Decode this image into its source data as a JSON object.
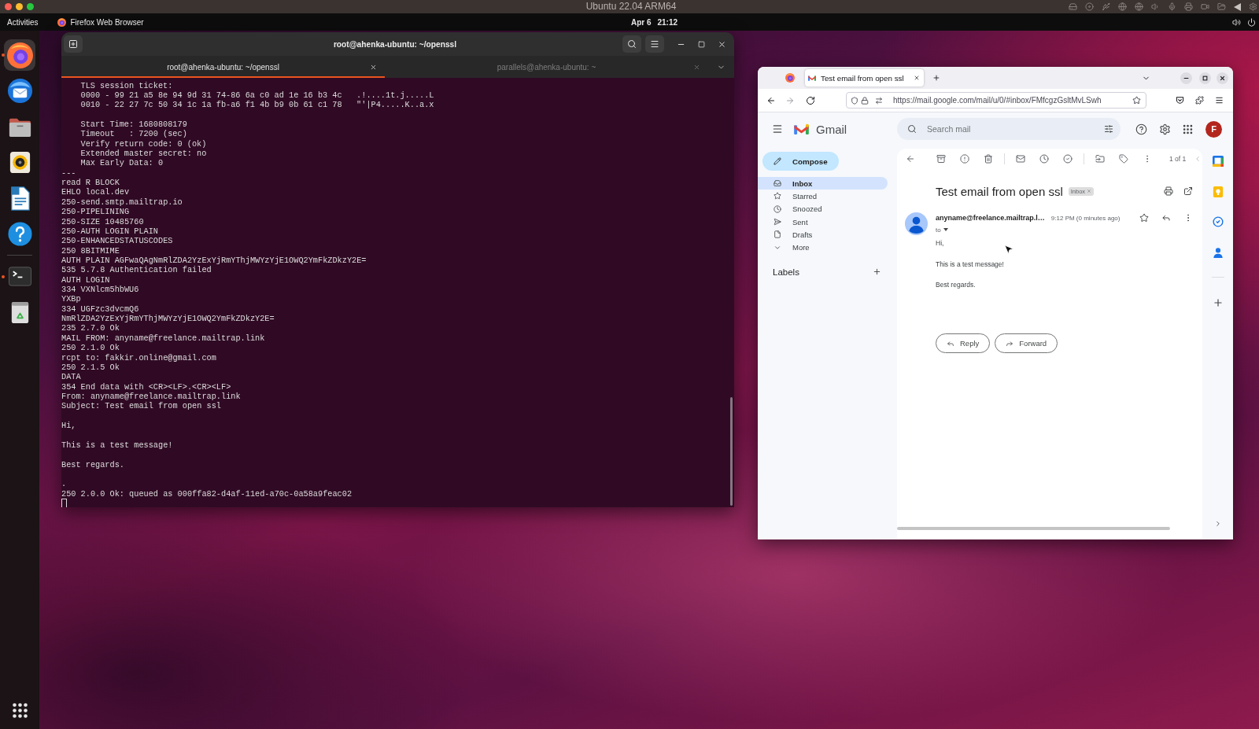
{
  "host_window": {
    "title": "Ubuntu 22.04 ARM64"
  },
  "top_bar": {
    "activities": "Activities",
    "app_menu": "Firefox Web Browser",
    "date": "Apr 6",
    "time": "21:12"
  },
  "dock": {
    "items": [
      {
        "kind": "browser",
        "running": true,
        "selected": true
      },
      {
        "kind": "mail",
        "running": false,
        "selected": false
      },
      {
        "kind": "files",
        "running": false,
        "selected": false
      },
      {
        "kind": "music",
        "running": false,
        "selected": false
      },
      {
        "kind": "writer",
        "running": false,
        "selected": false
      },
      {
        "kind": "help",
        "running": false,
        "selected": false
      }
    ],
    "extra_items": [
      {
        "kind": "terminal",
        "running": true,
        "selected": false
      },
      {
        "kind": "trash",
        "running": false,
        "selected": false
      }
    ]
  },
  "terminal": {
    "title": "root@ahenka-ubuntu: ~/openssl",
    "tabs": [
      {
        "label": "root@ahenka-ubuntu: ~/openssl",
        "selected": true
      },
      {
        "label": "parallels@ahenka-ubuntu: ~",
        "selected": false
      }
    ],
    "paragraphs": [
      {
        "indented_lines": [
          "TLS session ticket:",
          "0000 - 99 21 a5 8e 94 9d 31 74-86 6a c0 ad 1e 16 b3 4c   .!....1t.j.....L",
          "0010 - 22 27 7c 50 34 1c 1a fb-a6 f1 4b b9 0b 61 c1 78   \"'|P4.....K..a.x"
        ]
      },
      {
        "indented_lines": [
          "Start Time: 1680808179",
          "Timeout   : 7200 (sec)",
          "Verify return code: 0 (ok)",
          "Extended master secret: no",
          "Max Early Data: 0"
        ],
        "lines": [
          "---",
          "read R BLOCK",
          "EHLO local.dev",
          "250-send.smtp.mailtrap.io",
          "250-PIPELINING",
          "250-SIZE 10485760",
          "250-AUTH LOGIN PLAIN",
          "250-ENHANCEDSTATUSCODES",
          "250 8BITMIME",
          "AUTH PLAIN AGFwaQAgNmRlZDA2YzExYjRmYThjMWYzYjE1OWQ2YmFkZDkzY2E=",
          "535 5.7.8 Authentication failed",
          "AUTH LOGIN",
          "334 VXNlcm5hbWU6",
          "YXBp",
          "334 UGFzc3dvcmQ6",
          "NmRlZDA2YzExYjRmYThjMWYzYjE1OWQ2YmFkZDkzY2E=",
          "235 2.7.0 Ok",
          "MAIL FROM: anyname@freelance.mailtrap.link",
          "250 2.1.0 Ok",
          "rcpt to: fakkir.online@gmail.com",
          "250 2.1.5 Ok",
          "DATA",
          "354 End data with <CR><LF>.<CR><LF>",
          "From: anyname@freelance.mailtrap.link",
          "Subject: Test email from open ssl"
        ]
      },
      {
        "lines": [
          "Hi,"
        ]
      },
      {
        "lines": [
          "This is a test message!"
        ]
      },
      {
        "lines": [
          "Best regards."
        ]
      },
      {
        "lines": [
          ".",
          "250 2.0.0 Ok: queued as 000ffa82-d4af-11ed-a70c-0a58a9feac02"
        ]
      }
    ]
  },
  "browser": {
    "tabs": [
      {
        "title": "Test email from open ssl",
        "selected": true
      }
    ],
    "url": "https://mail.google.com/mail/u/0/#inbox/FMfcgzGsltMvLSwh",
    "gmail": {
      "app_name": "Gmail",
      "search": {
        "placeholder": "Search mail"
      },
      "avatar_letter": "F",
      "compose": "Compose",
      "nav": [
        {
          "kind": "inbox",
          "label": "Inbox",
          "selected": true
        },
        {
          "kind": "starred",
          "label": "Starred",
          "selected": false
        },
        {
          "kind": "snoozed",
          "label": "Snoozed",
          "selected": false
        },
        {
          "kind": "sent",
          "label": "Sent",
          "selected": false
        },
        {
          "kind": "drafts",
          "label": "Drafts",
          "selected": false
        },
        {
          "kind": "more",
          "label": "More",
          "selected": false
        }
      ],
      "labels_heading": "Labels",
      "pager": "1 of 1",
      "message": {
        "subject": "Test email from open ssl",
        "label_chip": "Inbox",
        "sender": "anyname@freelance.mailtrap.l…",
        "time": "9:12 PM (0 minutes ago)",
        "recipient": "to",
        "body": [
          "Hi,",
          "This is a test message!",
          "Best regards."
        ]
      },
      "actions": [
        {
          "kind": "reply",
          "label": "Reply"
        },
        {
          "kind": "forward",
          "label": "Forward"
        }
      ]
    }
  }
}
